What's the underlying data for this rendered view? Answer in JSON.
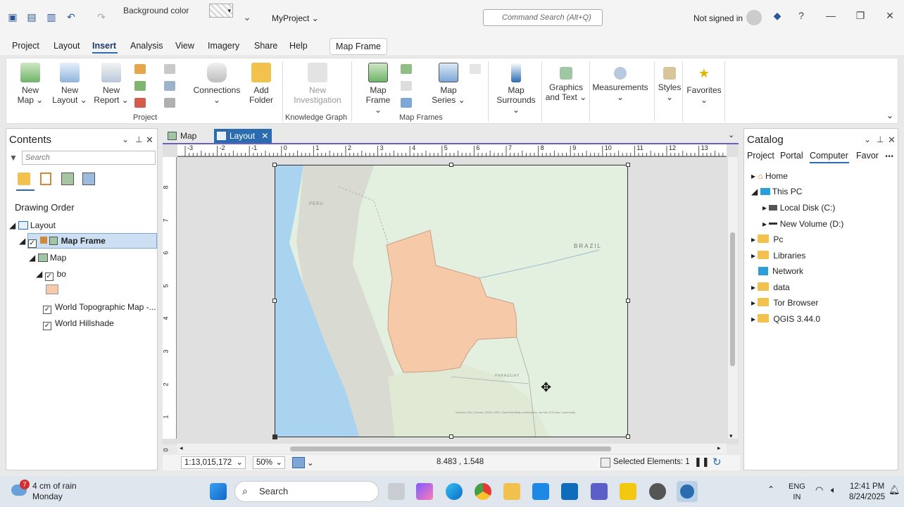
{
  "titlebar": {
    "bg_color_label": "Background color",
    "project_name": "MyProject",
    "command_search_placeholder": "Command Search (Alt+Q)",
    "signin": "Not signed in",
    "help": "?"
  },
  "menu": {
    "tabs": [
      "Project",
      "Layout",
      "Insert",
      "Analysis",
      "View",
      "Imagery",
      "Share",
      "Help"
    ],
    "contextual_tab": "Map Frame"
  },
  "ribbon": {
    "new_map": [
      "New",
      "Map"
    ],
    "new_layout": [
      "New",
      "Layout"
    ],
    "new_report": [
      "New",
      "Report"
    ],
    "connections": "Connections",
    "add_folder": [
      "Add",
      "Folder"
    ],
    "new_investigation": [
      "New",
      "Investigation"
    ],
    "map_frame": [
      "Map",
      "Frame"
    ],
    "map_series": [
      "Map",
      "Series"
    ],
    "map_surrounds": [
      "Map",
      "Surrounds"
    ],
    "graphics_text": [
      "Graphics",
      "and Text"
    ],
    "measurements": "Measurements",
    "styles": "Styles",
    "favorites": "Favorites",
    "groups": {
      "project": "Project",
      "knowledge_graph": "Knowledge Graph",
      "map_frames": "Map Frames"
    }
  },
  "contents": {
    "title": "Contents",
    "search_placeholder": "Search",
    "section": "Drawing Order",
    "items": {
      "layout": "Layout",
      "map_frame": "Map Frame",
      "map": "Map",
      "bo": "bo",
      "topo": "World Topographic Map -...",
      "hillshade": "World Hillshade"
    }
  },
  "view": {
    "tabs": [
      "Map",
      "Layout"
    ],
    "ruler_top": [
      "-3",
      "-2",
      "-1",
      "0",
      "1",
      "2",
      "3",
      "4",
      "5",
      "6",
      "7",
      "8",
      "9",
      "10",
      "11",
      "12",
      "13"
    ],
    "ruler_left": [
      "8",
      "7",
      "6",
      "5",
      "4",
      "3",
      "2",
      "1",
      "0"
    ],
    "map_labels": {
      "peru": "PERU",
      "brazil": "BRAZIL",
      "paraguay": "PARAGUAY"
    },
    "attribution": "Sources: Esri, Garmin, USGS, NPS, OpenStreetMap contributors, and the GIS User Community"
  },
  "status": {
    "scale": "1:13,015,172",
    "zoom": "50%",
    "coords": "8.483 , 1.548",
    "selected": "Selected Elements: 1"
  },
  "catalog": {
    "title": "Catalog",
    "tabs": [
      "Project",
      "Portal",
      "Computer",
      "Favor"
    ],
    "items": [
      "Home",
      "This PC",
      "Local Disk (C:)",
      "New Volume (D:)",
      "Pc",
      "Libraries",
      "Network",
      "data",
      "Tor Browser",
      "QGIS 3.44.0"
    ]
  },
  "taskbar": {
    "weather_badge": "7",
    "weather_line1": "4 cm of rain",
    "weather_line2": "Monday",
    "search": "Search",
    "lang1": "ENG",
    "lang2": "IN",
    "time": "12:41 PM",
    "date": "8/24/2025"
  },
  "colors": {
    "accent": "#2b6cb0",
    "bolivia": "#f6c9a9",
    "ocean": "#a9d3ef"
  }
}
